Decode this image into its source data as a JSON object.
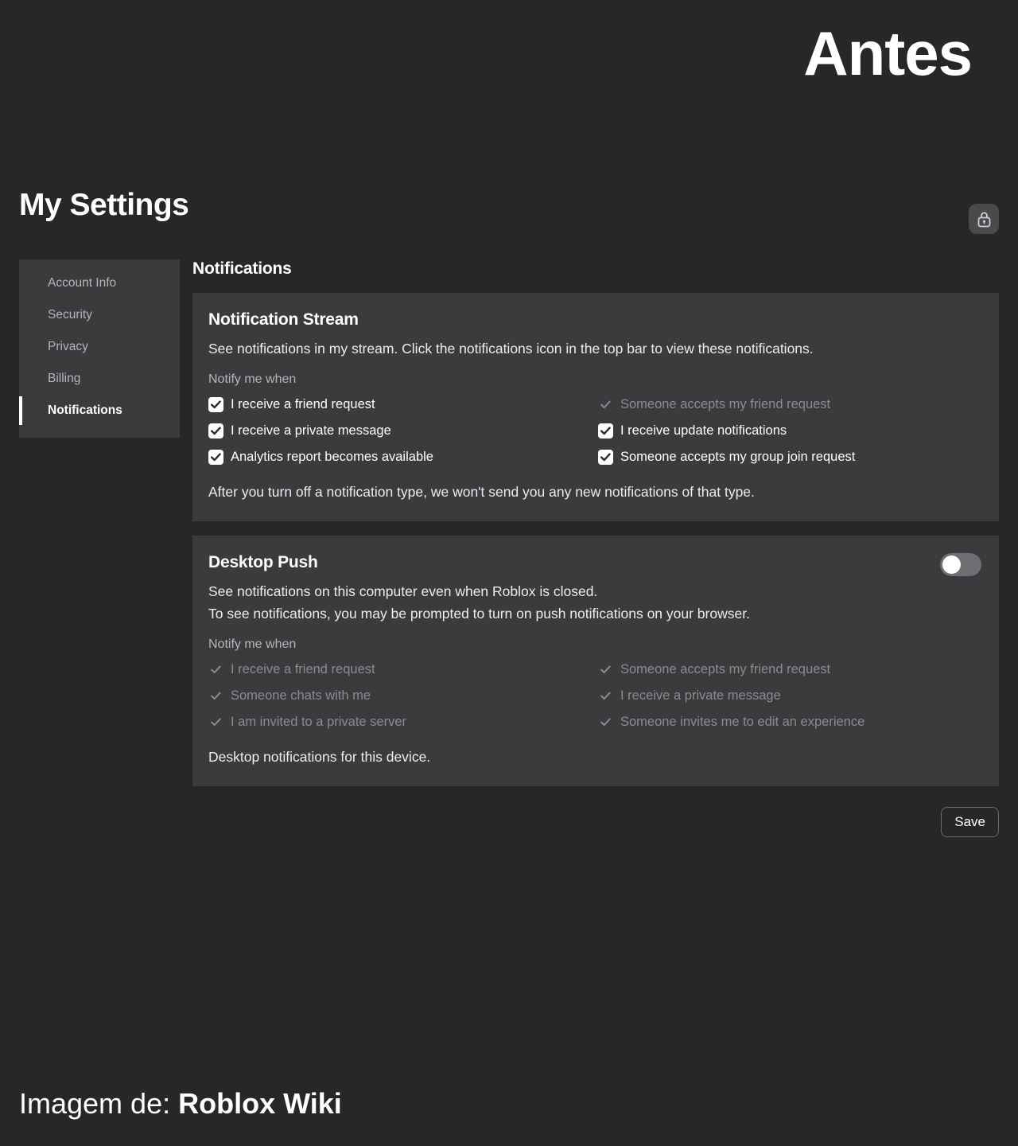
{
  "banner": {
    "title": "Antes"
  },
  "header": {
    "page_title": "My Settings",
    "lock_icon": "lock-icon"
  },
  "sidebar": {
    "items": [
      {
        "label": "Account Info",
        "active": false
      },
      {
        "label": "Security",
        "active": false
      },
      {
        "label": "Privacy",
        "active": false
      },
      {
        "label": "Billing",
        "active": false
      },
      {
        "label": "Notifications",
        "active": true
      }
    ]
  },
  "main": {
    "heading": "Notifications",
    "notification_stream": {
      "title": "Notification Stream",
      "description": "See notifications in my stream. Click the notifications icon in the top bar to view these notifications.",
      "notify_label": "Notify me when",
      "options": [
        {
          "label": "I receive a friend request",
          "checked": true,
          "disabled": false
        },
        {
          "label": "Someone accepts my friend request",
          "checked": true,
          "disabled": true
        },
        {
          "label": "I receive a private message",
          "checked": true,
          "disabled": false
        },
        {
          "label": "I receive update notifications",
          "checked": true,
          "disabled": false
        },
        {
          "label": "Analytics report becomes available",
          "checked": true,
          "disabled": false
        },
        {
          "label": "Someone accepts my group join request",
          "checked": true,
          "disabled": false
        }
      ],
      "footer": "After you turn off a notification type, we won't send you any new notifications of that type."
    },
    "desktop_push": {
      "title": "Desktop Push",
      "toggle_state": "off",
      "description_line1": "See notifications on this computer even when Roblox is closed.",
      "description_line2": "To see notifications, you may be prompted to turn on push notifications on your browser.",
      "notify_label": "Notify me when",
      "options": [
        {
          "label": "I receive a friend request",
          "checked": true,
          "disabled": true
        },
        {
          "label": "Someone accepts my friend request",
          "checked": true,
          "disabled": true
        },
        {
          "label": "Someone chats with me",
          "checked": true,
          "disabled": true
        },
        {
          "label": "I receive a private message",
          "checked": true,
          "disabled": true
        },
        {
          "label": "I am invited to a private server",
          "checked": true,
          "disabled": true
        },
        {
          "label": "Someone invites me to edit an experience",
          "checked": true,
          "disabled": true
        }
      ],
      "footer": "Desktop notifications for this device."
    },
    "save_label": "Save"
  },
  "caption": {
    "prefix": "Imagem de:",
    "source": "Roblox Wiki"
  },
  "colors": {
    "page_background": "#27272a",
    "card_background": "#3b3b3e",
    "accent_text": "#ffffff",
    "muted_text": "#b6b6ba",
    "disabled_text": "#8b8b90"
  }
}
